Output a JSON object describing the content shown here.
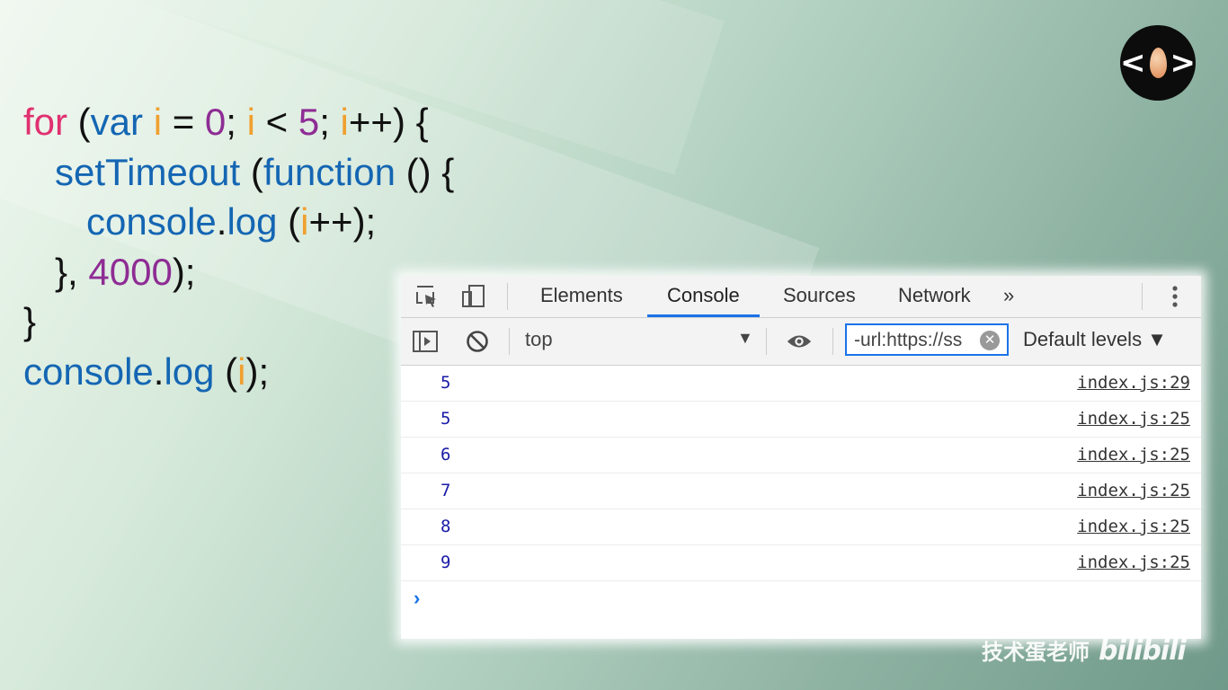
{
  "code_lines": [
    [
      {
        "t": "for",
        "c": "kw"
      },
      {
        "t": " (",
        "c": "pn"
      },
      {
        "t": "var",
        "c": "blue"
      },
      {
        "t": " ",
        "c": "pn"
      },
      {
        "t": "i",
        "c": "var"
      },
      {
        "t": " = ",
        "c": "pn"
      },
      {
        "t": "0",
        "c": "num"
      },
      {
        "t": "; ",
        "c": "pn"
      },
      {
        "t": "i",
        "c": "var"
      },
      {
        "t": " < ",
        "c": "pn"
      },
      {
        "t": "5",
        "c": "num"
      },
      {
        "t": "; ",
        "c": "pn"
      },
      {
        "t": "i",
        "c": "var"
      },
      {
        "t": "++) {",
        "c": "pn"
      }
    ],
    [
      {
        "t": "   ",
        "c": "pn"
      },
      {
        "t": "setTimeout",
        "c": "blue"
      },
      {
        "t": " (",
        "c": "pn"
      },
      {
        "t": "function",
        "c": "blue"
      },
      {
        "t": " () {",
        "c": "pn"
      }
    ],
    [
      {
        "t": "      ",
        "c": "pn"
      },
      {
        "t": "console",
        "c": "blue"
      },
      {
        "t": ".",
        "c": "pn"
      },
      {
        "t": "log",
        "c": "blue"
      },
      {
        "t": " (",
        "c": "pn"
      },
      {
        "t": "i",
        "c": "var"
      },
      {
        "t": "++);",
        "c": "pn"
      }
    ],
    [
      {
        "t": "   }, ",
        "c": "pn"
      },
      {
        "t": "4000",
        "c": "num"
      },
      {
        "t": ");",
        "c": "pn"
      }
    ],
    [
      {
        "t": "}",
        "c": "pn"
      }
    ],
    [
      {
        "t": "console",
        "c": "blue"
      },
      {
        "t": ".",
        "c": "pn"
      },
      {
        "t": "log",
        "c": "blue"
      },
      {
        "t": " (",
        "c": "pn"
      },
      {
        "t": "i",
        "c": "var"
      },
      {
        "t": ");",
        "c": "pn"
      }
    ]
  ],
  "devtools": {
    "tabs": [
      "Elements",
      "Console",
      "Sources",
      "Network"
    ],
    "more": "»",
    "context": "top",
    "filter": "-url:https://ss",
    "levels": "Default levels ▼",
    "rows": [
      {
        "value": "5",
        "source": "index.js:29"
      },
      {
        "value": "5",
        "source": "index.js:25"
      },
      {
        "value": "6",
        "source": "index.js:25"
      },
      {
        "value": "7",
        "source": "index.js:25"
      },
      {
        "value": "8",
        "source": "index.js:25"
      },
      {
        "value": "9",
        "source": "index.js:25"
      }
    ],
    "prompt": "›"
  },
  "watermark": {
    "author": "技术蛋老师",
    "site": "bilibili"
  }
}
